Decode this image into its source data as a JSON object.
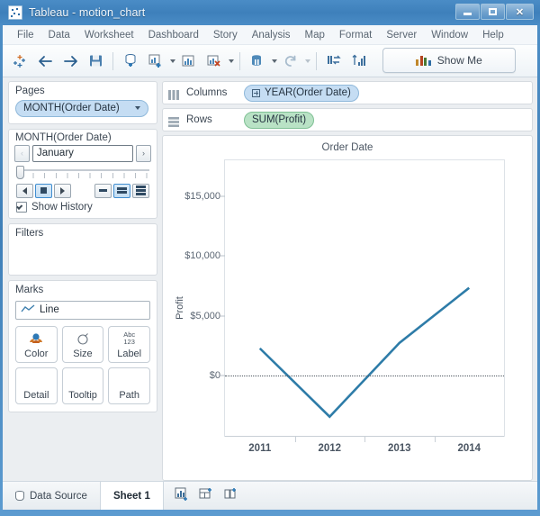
{
  "window": {
    "title": "Tableau - motion_chart",
    "app_icon": "tableau-icon",
    "minimize_label": "Minimize",
    "maximize_label": "Maximize",
    "close_label": "Close"
  },
  "menubar": {
    "items": [
      {
        "label": "File"
      },
      {
        "label": "Data"
      },
      {
        "label": "Worksheet"
      },
      {
        "label": "Dashboard"
      },
      {
        "label": "Story"
      },
      {
        "label": "Analysis"
      },
      {
        "label": "Map"
      },
      {
        "label": "Format"
      },
      {
        "label": "Server"
      },
      {
        "label": "Window"
      },
      {
        "label": "Help"
      }
    ]
  },
  "toolbar": {
    "icons": [
      {
        "name": "tableau-start-icon"
      },
      {
        "name": "back-arrow-icon"
      },
      {
        "name": "forward-arrow-icon"
      },
      {
        "name": "save-icon"
      },
      {
        "name": "connect-data-icon"
      },
      {
        "name": "new-worksheet-icon"
      },
      {
        "name": "duplicate-sheet-icon"
      },
      {
        "name": "clear-sheet-icon"
      },
      {
        "name": "swap-rows-columns-icon"
      },
      {
        "name": "refresh-icon"
      },
      {
        "name": "sort-ascending-icon"
      },
      {
        "name": "sort-descending-icon"
      }
    ],
    "show_me": {
      "label": "Show Me",
      "icon": "bar-chart-icon"
    }
  },
  "pages": {
    "title": "Pages",
    "pill_label": "MONTH(Order Date)"
  },
  "page_control": {
    "title": "MONTH(Order Date)",
    "prev_label": "‹",
    "next_label": "›",
    "current_value": "January",
    "playback": {
      "back_label": "Step back",
      "stop_label": "Stop",
      "forward_label": "Play forward"
    },
    "speed": {
      "slow_label": "Slow",
      "medium_label": "Medium",
      "fast_label": "Fast"
    },
    "show_history": {
      "label": "Show History",
      "checked": true
    }
  },
  "filters": {
    "title": "Filters"
  },
  "marks": {
    "title": "Marks",
    "mark_type": "Line",
    "mark_type_icon": "line-chart-icon",
    "buttons": [
      {
        "label": "Color",
        "icon": "color-palette-icon"
      },
      {
        "label": "Size",
        "icon": "size-icon"
      },
      {
        "label": "Label",
        "icon": "abc-123-icon",
        "glyph_line1": "Abc",
        "glyph_line2": "123"
      },
      {
        "label": "Detail",
        "icon": "detail-icon"
      },
      {
        "label": "Tooltip",
        "icon": "tooltip-icon"
      },
      {
        "label": "Path",
        "icon": "path-icon"
      }
    ]
  },
  "shelves": {
    "columns": {
      "name": "Columns",
      "icon": "columns-icon",
      "pill": "YEAR(Order Date)",
      "pill_type": "dimension",
      "expandable": true
    },
    "rows": {
      "name": "Rows",
      "icon": "rows-icon",
      "pill": "SUM(Profit)",
      "pill_type": "measure",
      "expandable": false
    }
  },
  "chart_data": {
    "type": "line",
    "title": "Order Date",
    "xlabel": "",
    "ylabel": "Profit",
    "x": [
      "2011",
      "2012",
      "2013",
      "2014"
    ],
    "categories": [
      "2011",
      "2012",
      "2013",
      "2014"
    ],
    "values": [
      2300,
      -3400,
      2750,
      7350
    ],
    "series": [
      {
        "name": "SUM(Profit)",
        "values": [
          2300,
          -3400,
          2750,
          7350
        ],
        "color": "#2e7ca8"
      }
    ],
    "ylim": [
      -5000,
      18000
    ],
    "yticks": [
      0,
      5000,
      10000,
      15000
    ],
    "ytick_labels": [
      "$0",
      "$5,000",
      "$10,000",
      "$15,000"
    ],
    "grid": false,
    "zero_line": true,
    "legend": "none",
    "line_color": "#2e7ca8"
  },
  "bottombar": {
    "tabs": [
      {
        "label": "Data Source",
        "icon": "database-icon",
        "active": false
      },
      {
        "label": "Sheet 1",
        "icon": "",
        "active": true
      }
    ],
    "new_buttons": [
      {
        "name": "new-worksheet-icon"
      },
      {
        "name": "new-dashboard-icon"
      },
      {
        "name": "new-story-icon"
      }
    ]
  },
  "colors": {
    "accent": "#2e7ca8",
    "dimension_pill": "#c5ddf3",
    "measure_pill": "#b9e2c5",
    "titlebar": "#4a8cc6"
  }
}
